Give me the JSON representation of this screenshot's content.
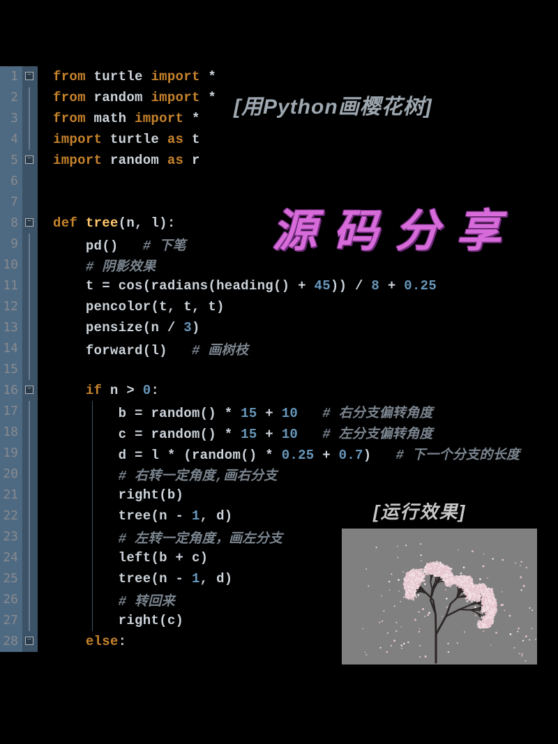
{
  "overlay": {
    "title_bracket": "[用Python画樱花树]",
    "big_title": "源码分享",
    "run_label": "[运行效果]"
  },
  "code": {
    "lines": [
      {
        "n": 1,
        "fold": "minus",
        "tokens": [
          [
            "kw",
            "from"
          ],
          [
            "op",
            " "
          ],
          [
            "ident",
            "turtle"
          ],
          [
            "op",
            " "
          ],
          [
            "kw",
            "import"
          ],
          [
            "op",
            " *"
          ]
        ]
      },
      {
        "n": 2,
        "fold": "bar",
        "tokens": [
          [
            "kw",
            "from"
          ],
          [
            "op",
            " "
          ],
          [
            "ident",
            "random"
          ],
          [
            "op",
            " "
          ],
          [
            "kw",
            "import"
          ],
          [
            "op",
            " *"
          ]
        ]
      },
      {
        "n": 3,
        "fold": "bar",
        "tokens": [
          [
            "kw",
            "from"
          ],
          [
            "op",
            " "
          ],
          [
            "ident",
            "math"
          ],
          [
            "op",
            " "
          ],
          [
            "kw",
            "import"
          ],
          [
            "op",
            " *"
          ]
        ]
      },
      {
        "n": 4,
        "fold": "bar",
        "tokens": [
          [
            "kw",
            "import"
          ],
          [
            "op",
            " "
          ],
          [
            "ident",
            "turtle"
          ],
          [
            "op",
            " "
          ],
          [
            "kw",
            "as"
          ],
          [
            "op",
            " "
          ],
          [
            "ident",
            "t"
          ]
        ]
      },
      {
        "n": 5,
        "fold": "minus",
        "tokens": [
          [
            "kw",
            "import"
          ],
          [
            "op",
            " "
          ],
          [
            "ident",
            "random"
          ],
          [
            "op",
            " "
          ],
          [
            "kw",
            "as"
          ],
          [
            "op",
            " "
          ],
          [
            "ident",
            "r"
          ]
        ]
      },
      {
        "n": 6,
        "fold": "",
        "tokens": []
      },
      {
        "n": 7,
        "fold": "",
        "tokens": []
      },
      {
        "n": 8,
        "fold": "minus",
        "tokens": [
          [
            "kw",
            "def"
          ],
          [
            "op",
            " "
          ],
          [
            "deffn",
            "tree"
          ],
          [
            "op",
            "("
          ],
          [
            "param",
            "n"
          ],
          [
            "op",
            ", "
          ],
          [
            "param",
            "l"
          ],
          [
            "op",
            "):"
          ]
        ]
      },
      {
        "n": 9,
        "fold": "bar",
        "indent": 1,
        "tokens": [
          [
            "fn",
            "pd"
          ],
          [
            "op",
            "()   "
          ],
          [
            "comment",
            "# 下笔"
          ]
        ]
      },
      {
        "n": 10,
        "fold": "bar",
        "indent": 1,
        "tokens": [
          [
            "comment",
            "# 阴影效果"
          ]
        ]
      },
      {
        "n": 11,
        "fold": "bar",
        "indent": 1,
        "tokens": [
          [
            "ident",
            "t"
          ],
          [
            "op",
            " = "
          ],
          [
            "fn",
            "cos"
          ],
          [
            "op",
            "("
          ],
          [
            "fn",
            "radians"
          ],
          [
            "op",
            "("
          ],
          [
            "fn",
            "heading"
          ],
          [
            "op",
            "() + "
          ],
          [
            "num",
            "45"
          ],
          [
            "op",
            ")) / "
          ],
          [
            "num",
            "8"
          ],
          [
            "op",
            " + "
          ],
          [
            "num",
            "0.25"
          ]
        ]
      },
      {
        "n": 12,
        "fold": "bar",
        "indent": 1,
        "tokens": [
          [
            "fn",
            "pencolor"
          ],
          [
            "op",
            "("
          ],
          [
            "ident",
            "t"
          ],
          [
            "op",
            ", "
          ],
          [
            "ident",
            "t"
          ],
          [
            "op",
            ", "
          ],
          [
            "ident",
            "t"
          ],
          [
            "op",
            ")"
          ]
        ]
      },
      {
        "n": 13,
        "fold": "bar",
        "indent": 1,
        "tokens": [
          [
            "fn",
            "pensize"
          ],
          [
            "op",
            "("
          ],
          [
            "ident",
            "n"
          ],
          [
            "op",
            " / "
          ],
          [
            "num",
            "3"
          ],
          [
            "op",
            ")"
          ]
        ]
      },
      {
        "n": 14,
        "fold": "bar",
        "indent": 1,
        "tokens": [
          [
            "fn",
            "forward"
          ],
          [
            "op",
            "("
          ],
          [
            "ident",
            "l"
          ],
          [
            "op",
            ")   "
          ],
          [
            "comment",
            "# 画树枝"
          ]
        ]
      },
      {
        "n": 15,
        "fold": "bar",
        "indent": 0,
        "tokens": []
      },
      {
        "n": 16,
        "fold": "minus",
        "indent": 1,
        "tokens": [
          [
            "kw",
            "if"
          ],
          [
            "op",
            " "
          ],
          [
            "ident",
            "n"
          ],
          [
            "op",
            " > "
          ],
          [
            "num",
            "0"
          ],
          [
            "op",
            ":"
          ]
        ]
      },
      {
        "n": 17,
        "fold": "bar",
        "indent": 2,
        "guide": true,
        "tokens": [
          [
            "ident",
            "b"
          ],
          [
            "op",
            " = "
          ],
          [
            "fn",
            "random"
          ],
          [
            "op",
            "() * "
          ],
          [
            "num",
            "15"
          ],
          [
            "op",
            " + "
          ],
          [
            "num",
            "10"
          ],
          [
            "op",
            "   "
          ],
          [
            "comment",
            "# 右分支偏转角度"
          ]
        ]
      },
      {
        "n": 18,
        "fold": "bar",
        "indent": 2,
        "guide": true,
        "tokens": [
          [
            "ident",
            "c"
          ],
          [
            "op",
            " = "
          ],
          [
            "fn",
            "random"
          ],
          [
            "op",
            "() * "
          ],
          [
            "num",
            "15"
          ],
          [
            "op",
            " + "
          ],
          [
            "num",
            "10"
          ],
          [
            "op",
            "   "
          ],
          [
            "comment",
            "# 左分支偏转角度"
          ]
        ]
      },
      {
        "n": 19,
        "fold": "bar",
        "indent": 2,
        "guide": true,
        "tokens": [
          [
            "ident",
            "d"
          ],
          [
            "op",
            " = "
          ],
          [
            "ident",
            "l"
          ],
          [
            "op",
            " * ("
          ],
          [
            "fn",
            "random"
          ],
          [
            "op",
            "() * "
          ],
          [
            "num",
            "0.25"
          ],
          [
            "op",
            " + "
          ],
          [
            "num",
            "0.7"
          ],
          [
            "op",
            ")   "
          ],
          [
            "comment",
            "# 下一个分支的长度"
          ]
        ]
      },
      {
        "n": 20,
        "fold": "bar",
        "indent": 2,
        "guide": true,
        "tokens": [
          [
            "comment",
            "# 右转一定角度,画右分支"
          ]
        ]
      },
      {
        "n": 21,
        "fold": "bar",
        "indent": 2,
        "guide": true,
        "tokens": [
          [
            "fn",
            "right"
          ],
          [
            "op",
            "("
          ],
          [
            "ident",
            "b"
          ],
          [
            "op",
            ")"
          ]
        ]
      },
      {
        "n": 22,
        "fold": "bar",
        "indent": 2,
        "guide": true,
        "tokens": [
          [
            "fn",
            "tree"
          ],
          [
            "op",
            "("
          ],
          [
            "ident",
            "n"
          ],
          [
            "op",
            " - "
          ],
          [
            "num",
            "1"
          ],
          [
            "op",
            ", "
          ],
          [
            "ident",
            "d"
          ],
          [
            "op",
            ")"
          ]
        ]
      },
      {
        "n": 23,
        "fold": "bar",
        "indent": 2,
        "guide": true,
        "tokens": [
          [
            "comment",
            "# 左转一定角度，画左分支"
          ]
        ]
      },
      {
        "n": 24,
        "fold": "bar",
        "indent": 2,
        "guide": true,
        "tokens": [
          [
            "fn",
            "left"
          ],
          [
            "op",
            "("
          ],
          [
            "ident",
            "b"
          ],
          [
            "op",
            " + "
          ],
          [
            "ident",
            "c"
          ],
          [
            "op",
            ")"
          ]
        ]
      },
      {
        "n": 25,
        "fold": "bar",
        "indent": 2,
        "guide": true,
        "tokens": [
          [
            "fn",
            "tree"
          ],
          [
            "op",
            "("
          ],
          [
            "ident",
            "n"
          ],
          [
            "op",
            " - "
          ],
          [
            "num",
            "1"
          ],
          [
            "op",
            ", "
          ],
          [
            "ident",
            "d"
          ],
          [
            "op",
            ")"
          ]
        ]
      },
      {
        "n": 26,
        "fold": "bar",
        "indent": 2,
        "guide": true,
        "tokens": [
          [
            "comment",
            "# 转回来"
          ]
        ]
      },
      {
        "n": 27,
        "fold": "bar",
        "indent": 2,
        "guide": true,
        "tokens": [
          [
            "fn",
            "right"
          ],
          [
            "op",
            "("
          ],
          [
            "ident",
            "c"
          ],
          [
            "op",
            ")"
          ]
        ]
      },
      {
        "n": 28,
        "fold": "minus",
        "indent": 1,
        "tokens": [
          [
            "kw",
            "else"
          ],
          [
            "op",
            ":"
          ]
        ]
      }
    ]
  },
  "preview": {
    "alt": "cherry-blossom-tree-output"
  }
}
